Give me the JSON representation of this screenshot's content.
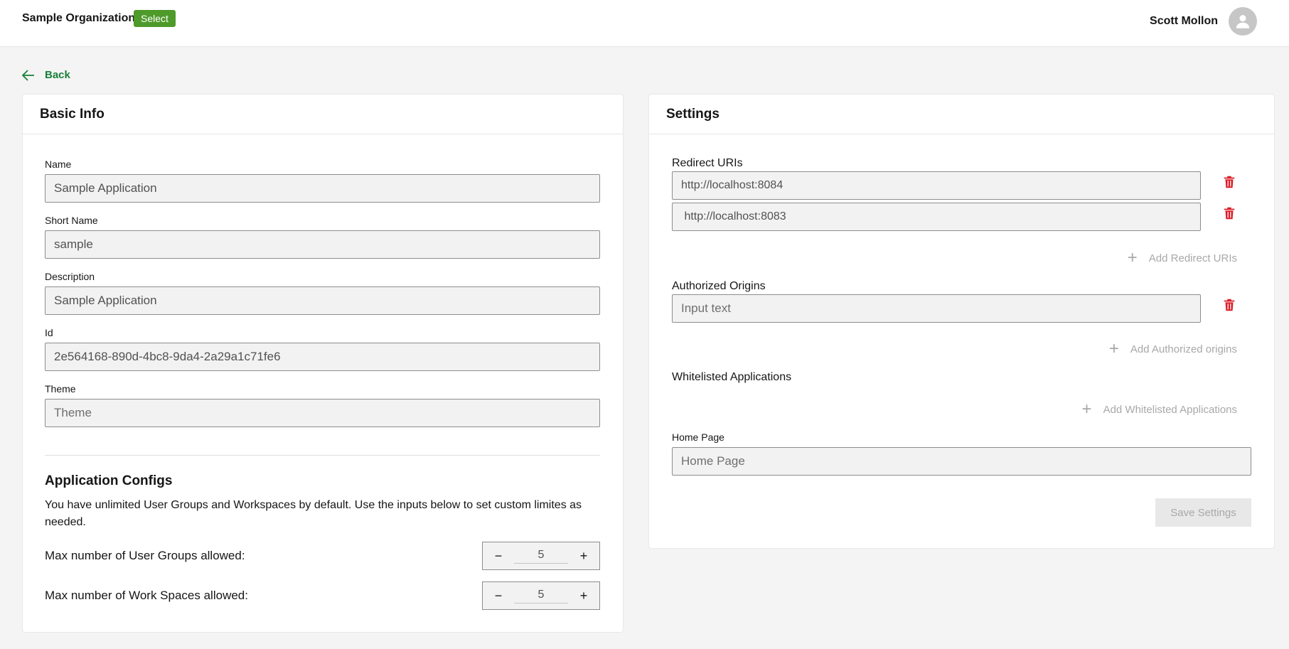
{
  "header": {
    "org_name": "Sample Organization",
    "select_label": "Select",
    "user_name": "Scott Mollon"
  },
  "back_label": "Back",
  "basic_info": {
    "title": "Basic Info",
    "fields": [
      {
        "label": "Name",
        "value": "Sample Application",
        "placeholder": ""
      },
      {
        "label": "Short Name",
        "value": "sample",
        "placeholder": ""
      },
      {
        "label": "Description",
        "value": "Sample Application",
        "placeholder": ""
      },
      {
        "label": "Id",
        "value": "2e564168-890d-4bc8-9da4-2a29a1c71fe6",
        "placeholder": ""
      },
      {
        "label": "Theme",
        "value": "",
        "placeholder": "Theme"
      }
    ],
    "configs_title": "Application Configs",
    "configs_desc": "You have unlimited User Groups and Workspaces by default. Use the inputs below to set custom limites as needed.",
    "limits": [
      {
        "label": "Max number of User Groups allowed:",
        "value": "5"
      },
      {
        "label": "Max number of Work Spaces allowed:",
        "value": "5"
      }
    ],
    "minus": "−",
    "plus": "+"
  },
  "settings": {
    "title": "Settings",
    "redirect_label": "Redirect URIs",
    "redirect_uris": [
      "http://localhost:8084",
      " http://localhost:8083"
    ],
    "add_redirect": "Add Redirect URIs",
    "origins_label": "Authorized Origins",
    "origin_placeholder": "Input text",
    "add_origins": "Add Authorized origins",
    "whitelisted_label": "Whitelisted Applications",
    "add_whitelisted": "Add Whitelisted Applications",
    "home_label": "Home Page",
    "home_placeholder": "Home Page",
    "save_label": "Save Settings",
    "add_plus": "+"
  },
  "colors": {
    "accent": "#24a148",
    "badge": "#4e9a2a",
    "danger": "#da1e28"
  }
}
